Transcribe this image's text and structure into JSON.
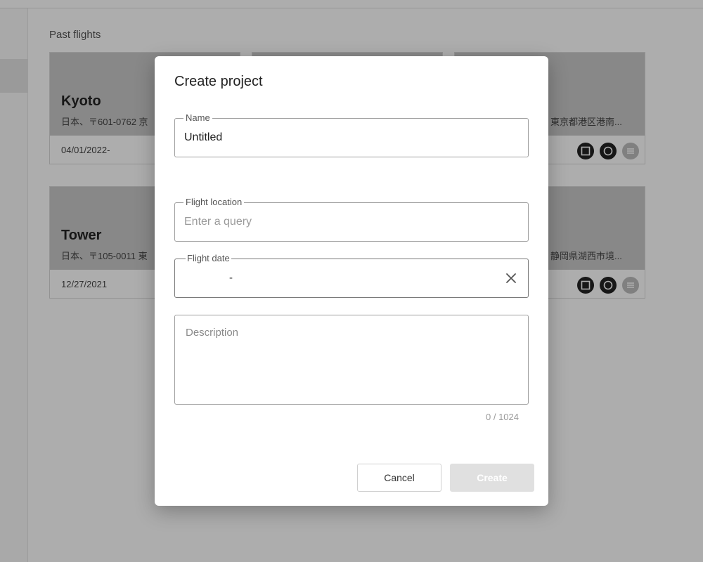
{
  "background": {
    "section_title": "Past flights",
    "cards": [
      {
        "title": "Kyoto",
        "address": "日本、〒601-0762 京",
        "date": "04/01/2022-"
      },
      {
        "title": "",
        "address": "",
        "date": ""
      },
      {
        "title": "",
        "address": "東京都港区港南...",
        "date": ""
      },
      {
        "title": "Tower",
        "address": "日本、〒105-0011 東",
        "date": "12/27/2021"
      },
      {
        "title": "",
        "address": "静岡県湖西市境...",
        "date": ""
      }
    ],
    "card_icons": [
      "square-icon",
      "circle-icon",
      "list-icon"
    ]
  },
  "dialog": {
    "title": "Create project",
    "name_field": {
      "label": "Name",
      "value": "Untitled"
    },
    "location_field": {
      "label": "Flight location",
      "placeholder": "Enter a query",
      "value": ""
    },
    "date_field": {
      "label": "Flight date",
      "separator": "-"
    },
    "description_field": {
      "placeholder": "Description",
      "value": ""
    },
    "counter": "0 / 1024",
    "cancel_label": "Cancel",
    "create_label": "Create"
  }
}
